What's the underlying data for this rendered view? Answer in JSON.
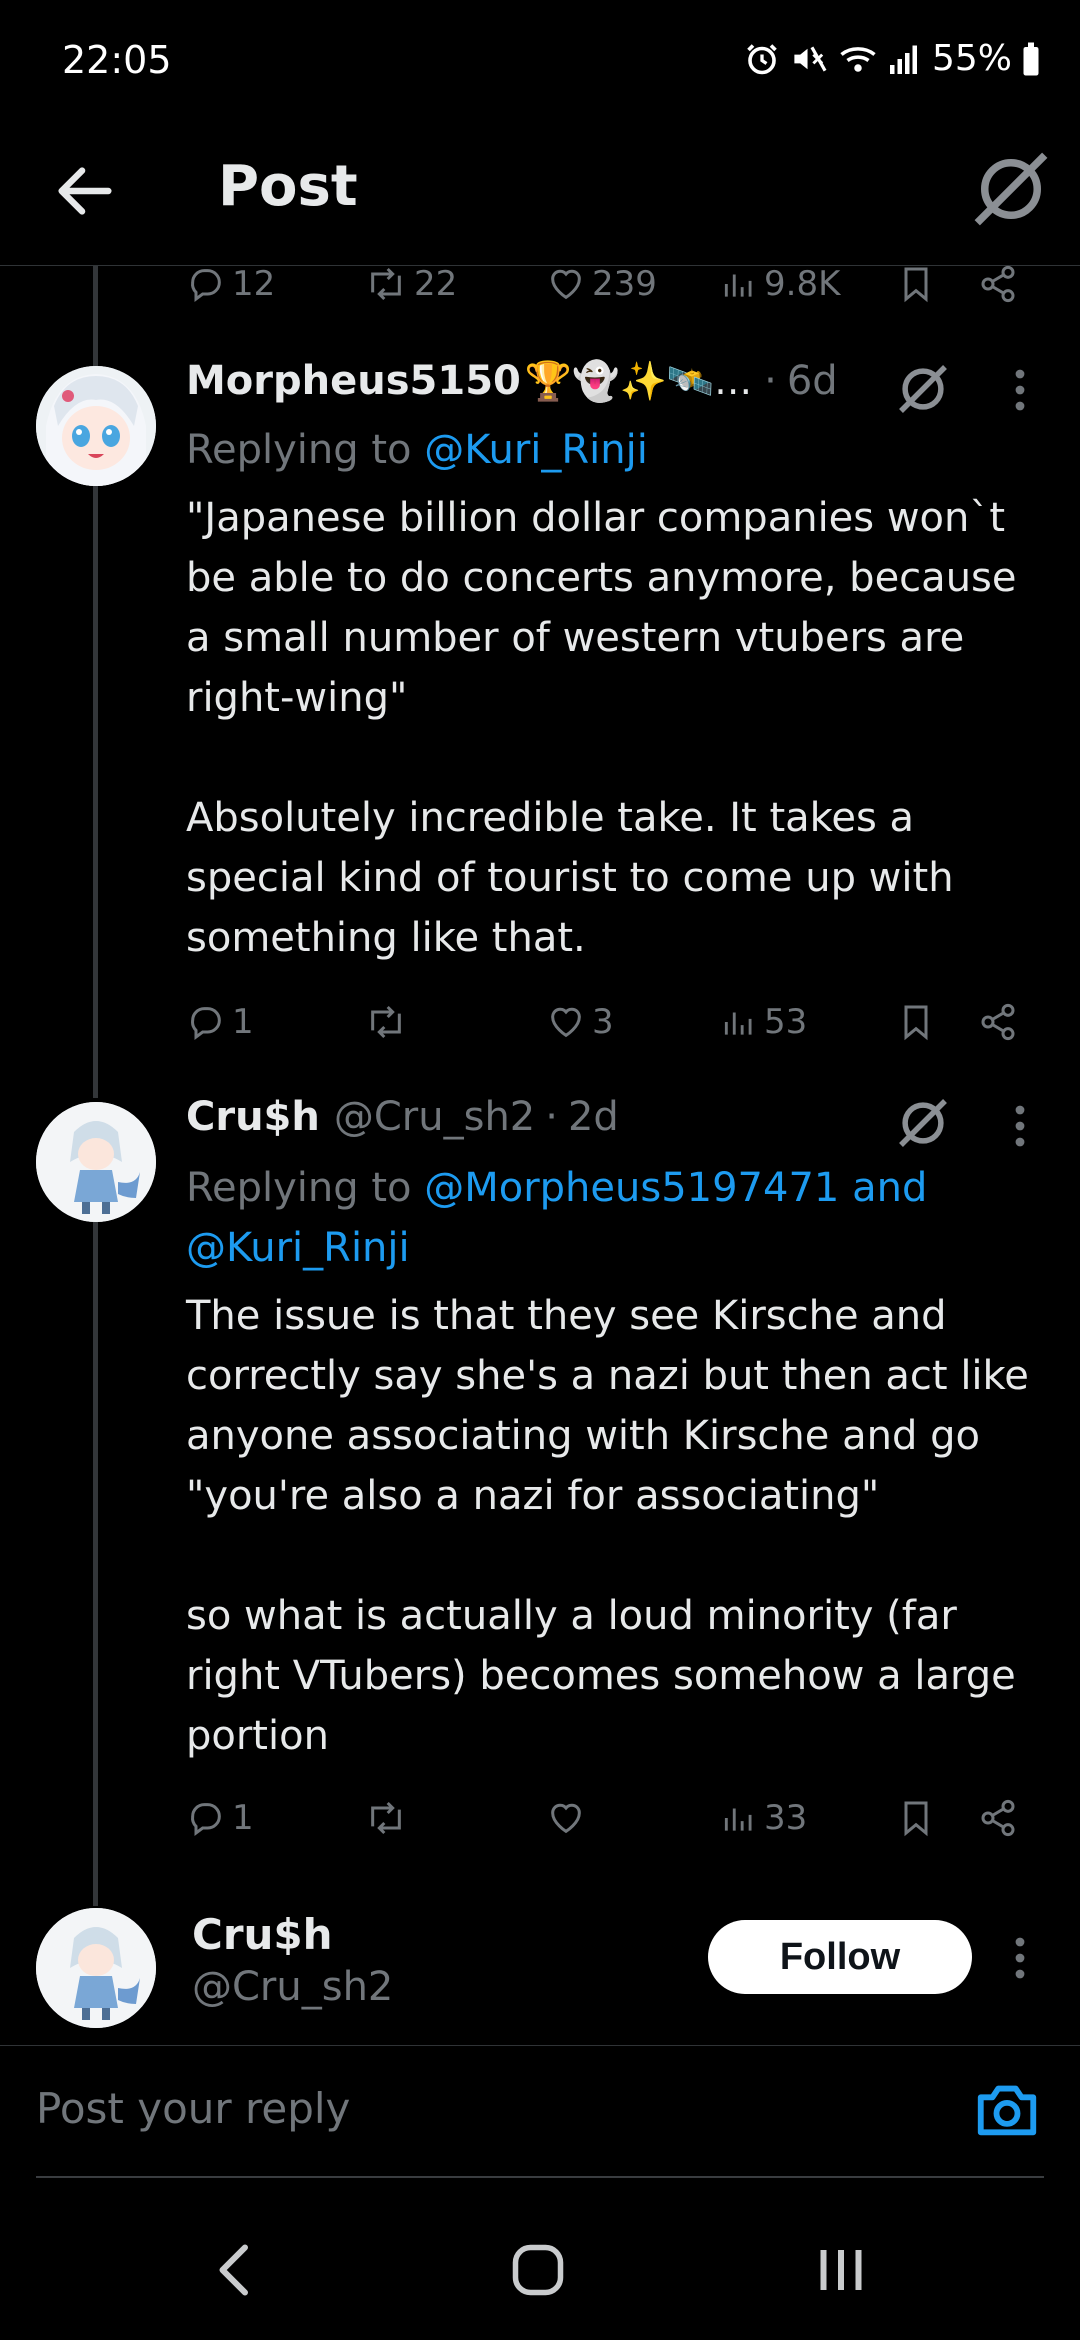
{
  "status_bar": {
    "time": "22:05",
    "battery": "55%",
    "icons": [
      "alarm-icon",
      "mute-icon",
      "wifi-icon",
      "signal-icon",
      "battery-icon"
    ]
  },
  "header": {
    "title": "Post",
    "back_icon": "arrow-left-icon",
    "grok_icon": "grok-icon"
  },
  "top_actions": {
    "replies": "12",
    "reposts": "22",
    "likes": "239",
    "views": "9.8K"
  },
  "tweets": [
    {
      "name": "Morpheus5150",
      "emoji": "🏆👻✨🛰️…",
      "sep": "·",
      "time": "6d",
      "replying_label": "Replying to ",
      "mention1": "@Kuri_Rinji",
      "body": "\"Japanese billion dollar companies won`t be able to do concerts anymore, because a small number of western vtubers are right-wing\"\n\nAbsolutely incredible take. It takes a special kind of tourist to come up with something like that.",
      "replies": "1",
      "reposts": "",
      "likes": "3",
      "views": "53"
    },
    {
      "name": "Cru$h",
      "handle": "@Cru_sh2",
      "sep": "·",
      "time": "2d",
      "replying_label": "Replying to ",
      "mention1": "@Morpheus5197471",
      "and_label": " and",
      "mention2": "@Kuri_Rinji",
      "body": "The issue is that they see Kirsche and correctly say she's a nazi but then act like anyone associating with Kirsche and go \"you're also a nazi for associating\"\n\nso what is actually a loud minority (far right VTubers) becomes somehow a large portion",
      "replies": "1",
      "reposts": "",
      "likes": "",
      "views": "33"
    }
  ],
  "profile": {
    "name": "Cru$h",
    "handle": "@Cru_sh2",
    "follow_label": "Follow"
  },
  "composer": {
    "placeholder": "Post your reply",
    "camera_icon": "camera-icon"
  },
  "nav": {
    "icons": [
      "nav-back-icon",
      "nav-home-icon",
      "nav-recents-icon"
    ]
  },
  "colors": {
    "background": "#000000",
    "text": "#e7e9ea",
    "muted": "#71767b",
    "accent": "#1d9bf0"
  }
}
